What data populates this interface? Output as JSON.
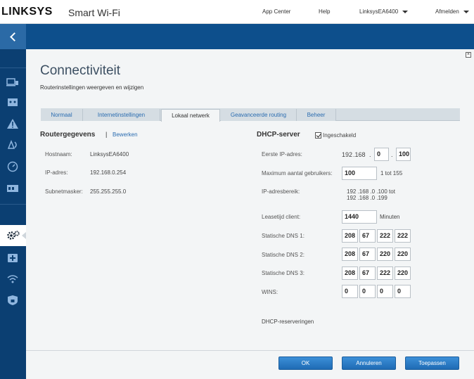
{
  "header": {
    "brand": "LINKSYS",
    "product": "Smart Wi-Fi",
    "links": [
      "App Center",
      "Help",
      "LinksysEA6400",
      "Afmelden"
    ]
  },
  "page": {
    "title": "Connectiviteit",
    "subtitle": "Routerinstellingen weergeven en wijzigen"
  },
  "tabs": [
    {
      "label": "Normaal"
    },
    {
      "label": "Internetinstellingen"
    },
    {
      "label": "Lokaal netwerk"
    },
    {
      "label": "Geavanceerde routing"
    },
    {
      "label": "Beheer"
    }
  ],
  "router": {
    "heading": "Routergegevens",
    "separator": "|",
    "edit_link": "Bewerken",
    "rows": [
      {
        "label": "Hostnaam:",
        "value": "LinksysEA6400"
      },
      {
        "label": "IP-adres:",
        "value": "192.168.0.254"
      },
      {
        "label": "Subnetmasker:",
        "value": "255.255.255.0"
      }
    ]
  },
  "dhcp": {
    "heading": "DHCP-server",
    "enabled_label": "Ingeschakeld",
    "enabled": true,
    "first_ip_label": "Eerste IP-adres:",
    "first_ip_prefix": [
      "192",
      ".168",
      "."
    ],
    "first_ip_octets": [
      "0",
      "100"
    ],
    "max_users_label": "Maximum aantal gebruikers:",
    "max_users_value": "100",
    "max_users_range": "1 tot 155",
    "range_label": "IP-adresbereik:",
    "range_line1": "192 .168 .0 .100  tot",
    "range_line2": "192 .168 .0 .199",
    "lease_label": "Leasetijd client:",
    "lease_value": "1440",
    "lease_unit": "Minuten",
    "dns1_label": "Statische DNS 1:",
    "dns1": [
      "208",
      "67",
      "222",
      "222"
    ],
    "dns2_label": "Statische DNS 2:",
    "dns2": [
      "208",
      "67",
      "220",
      "220"
    ],
    "dns3_label": "Statische DNS 3:",
    "dns3": [
      "208",
      "67",
      "222",
      "220"
    ],
    "wins_label": "WINS:",
    "wins": [
      "0",
      "0",
      "0",
      "0"
    ],
    "reservations_link": "DHCP-reserveringen"
  },
  "footer": {
    "ok": "OK",
    "cancel": "Annuleren",
    "apply": "Toepassen"
  },
  "sidebar": {
    "icons": [
      "device-list-icon",
      "parental-controls-icon",
      "troubleshooting-icon",
      "wireless-icon",
      "speed-check-icon",
      "media-prioritization-icon",
      "connectivity-gear-icon",
      "external-storage-icon",
      "wifi-settings-icon",
      "security-icon"
    ]
  }
}
